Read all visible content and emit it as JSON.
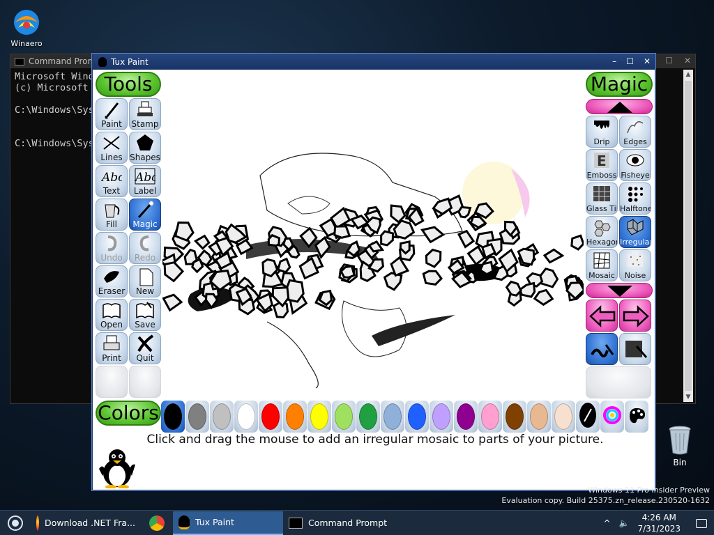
{
  "desktop": {
    "icons": [
      {
        "label": "Winaero"
      }
    ],
    "recycle_bin": {
      "label": "Bin"
    },
    "watermark": {
      "line1": "Windows 11 Pro Insider Preview",
      "line2": "Evaluation copy. Build 25375.zn_release.230520-1632"
    }
  },
  "cmd_window": {
    "title": "Command Prompt",
    "lines": [
      "Microsoft Wind",
      "(c) Microsoft",
      "",
      "C:\\Windows\\Sys",
      "",
      "",
      "C:\\Windows\\Sys"
    ]
  },
  "tuxpaint": {
    "title": "Tux Paint",
    "tools_header": "Tools",
    "magic_header": "Magic",
    "colors_header": "Colors",
    "tools": [
      {
        "label": "Paint",
        "icon": "paintbrush-icon"
      },
      {
        "label": "Stamp",
        "icon": "stamp-icon"
      },
      {
        "label": "Lines",
        "icon": "lines-icon"
      },
      {
        "label": "Shapes",
        "icon": "pentagon-icon"
      },
      {
        "label": "Text",
        "icon": "abc-text-icon"
      },
      {
        "label": "Label",
        "icon": "abc-label-icon"
      },
      {
        "label": "Fill",
        "icon": "paint-bucket-icon"
      },
      {
        "label": "Magic",
        "icon": "magic-wand-icon",
        "active": true
      },
      {
        "label": "Undo",
        "icon": "undo-icon",
        "disabled": true
      },
      {
        "label": "Redo",
        "icon": "redo-icon",
        "disabled": true
      },
      {
        "label": "Eraser",
        "icon": "eraser-icon"
      },
      {
        "label": "New",
        "icon": "new-page-icon"
      },
      {
        "label": "Open",
        "icon": "open-book-icon"
      },
      {
        "label": "Save",
        "icon": "save-book-icon"
      },
      {
        "label": "Print",
        "icon": "printer-icon"
      },
      {
        "label": "Quit",
        "icon": "quit-x-icon"
      }
    ],
    "magic_tools": [
      {
        "label": "Drip",
        "icon": "drip-icon"
      },
      {
        "label": "Edges",
        "icon": "edges-icon"
      },
      {
        "label": "Emboss",
        "icon": "emboss-icon"
      },
      {
        "label": "Fisheye",
        "icon": "fisheye-icon"
      },
      {
        "label": "Glass Tile",
        "icon": "glass-tile-icon"
      },
      {
        "label": "Halftone",
        "icon": "halftone-icon"
      },
      {
        "label": "Hexagon Mosaic",
        "icon": "hexagon-mosaic-icon"
      },
      {
        "label": "Irregular Mosaic",
        "icon": "irregular-mosaic-icon",
        "active": true
      },
      {
        "label": "Mosaic",
        "icon": "mosaic-icon"
      },
      {
        "label": "Noise",
        "icon": "noise-icon"
      }
    ],
    "colors": [
      "#000000",
      "#808080",
      "#c0c0c0",
      "#ffffff",
      "#ff0000",
      "#ff8000",
      "#ffff00",
      "#a0e060",
      "#20a040",
      "#8fb0d8",
      "#2060ff",
      "#c0a0ff",
      "#900090",
      "#ffa0d0",
      "#804000",
      "#e8b890",
      "#f8e0d0"
    ],
    "selected_color": "#000000",
    "tip": "Click and drag the mouse to add an irregular mosaic to parts of your picture."
  },
  "taskbar": {
    "items": [
      {
        "label": "Download .NET Fra...",
        "icon": "firefox-icon"
      },
      {
        "label": "",
        "icon": "chrome-icon"
      },
      {
        "label": "Tux Paint",
        "icon": "tux-icon",
        "active": true
      },
      {
        "label": "Command Prompt",
        "icon": "cmd-icon"
      }
    ],
    "time": "4:26 AM",
    "date": "7/31/2023"
  }
}
